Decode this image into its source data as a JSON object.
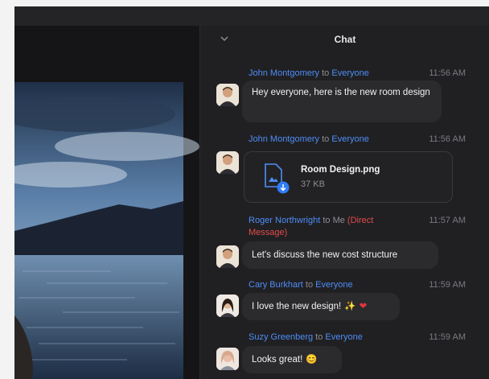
{
  "chat": {
    "title": "Chat",
    "to_word": "to",
    "messages": [
      {
        "sender": "John Montgomery",
        "recipient": "Everyone",
        "time": "11:56 AM",
        "text": "Hey everyone, here is the new room design"
      },
      {
        "sender": "John Montgomery",
        "recipient": "Everyone",
        "time": "11:56 AM",
        "file": {
          "name": "Room Design.png",
          "size": "37 KB"
        }
      },
      {
        "sender": "Roger Northwright",
        "recipient": "Me",
        "note": "(Direct Message)",
        "time": "11:57 AM",
        "text": "Let's discuss the new cost structure"
      },
      {
        "sender": "Cary Burkhart",
        "recipient": "Everyone",
        "time": "11:59 AM",
        "text": "I love the new design!",
        "emoji": [
          "✨",
          "❤"
        ]
      },
      {
        "sender": "Suzy Greenberg",
        "recipient": "Everyone",
        "time": "11:59 AM",
        "text": "Looks great!",
        "emoji": [
          "😊"
        ]
      }
    ]
  },
  "colors": {
    "sender": "#4e8df5",
    "direct_message": "#e04b4b",
    "bubble": "#2b2b2e",
    "panel": "#202023"
  },
  "icons": {
    "collapse": "chevron-down-icon",
    "file": "image-file-icon",
    "download": "download-icon"
  }
}
